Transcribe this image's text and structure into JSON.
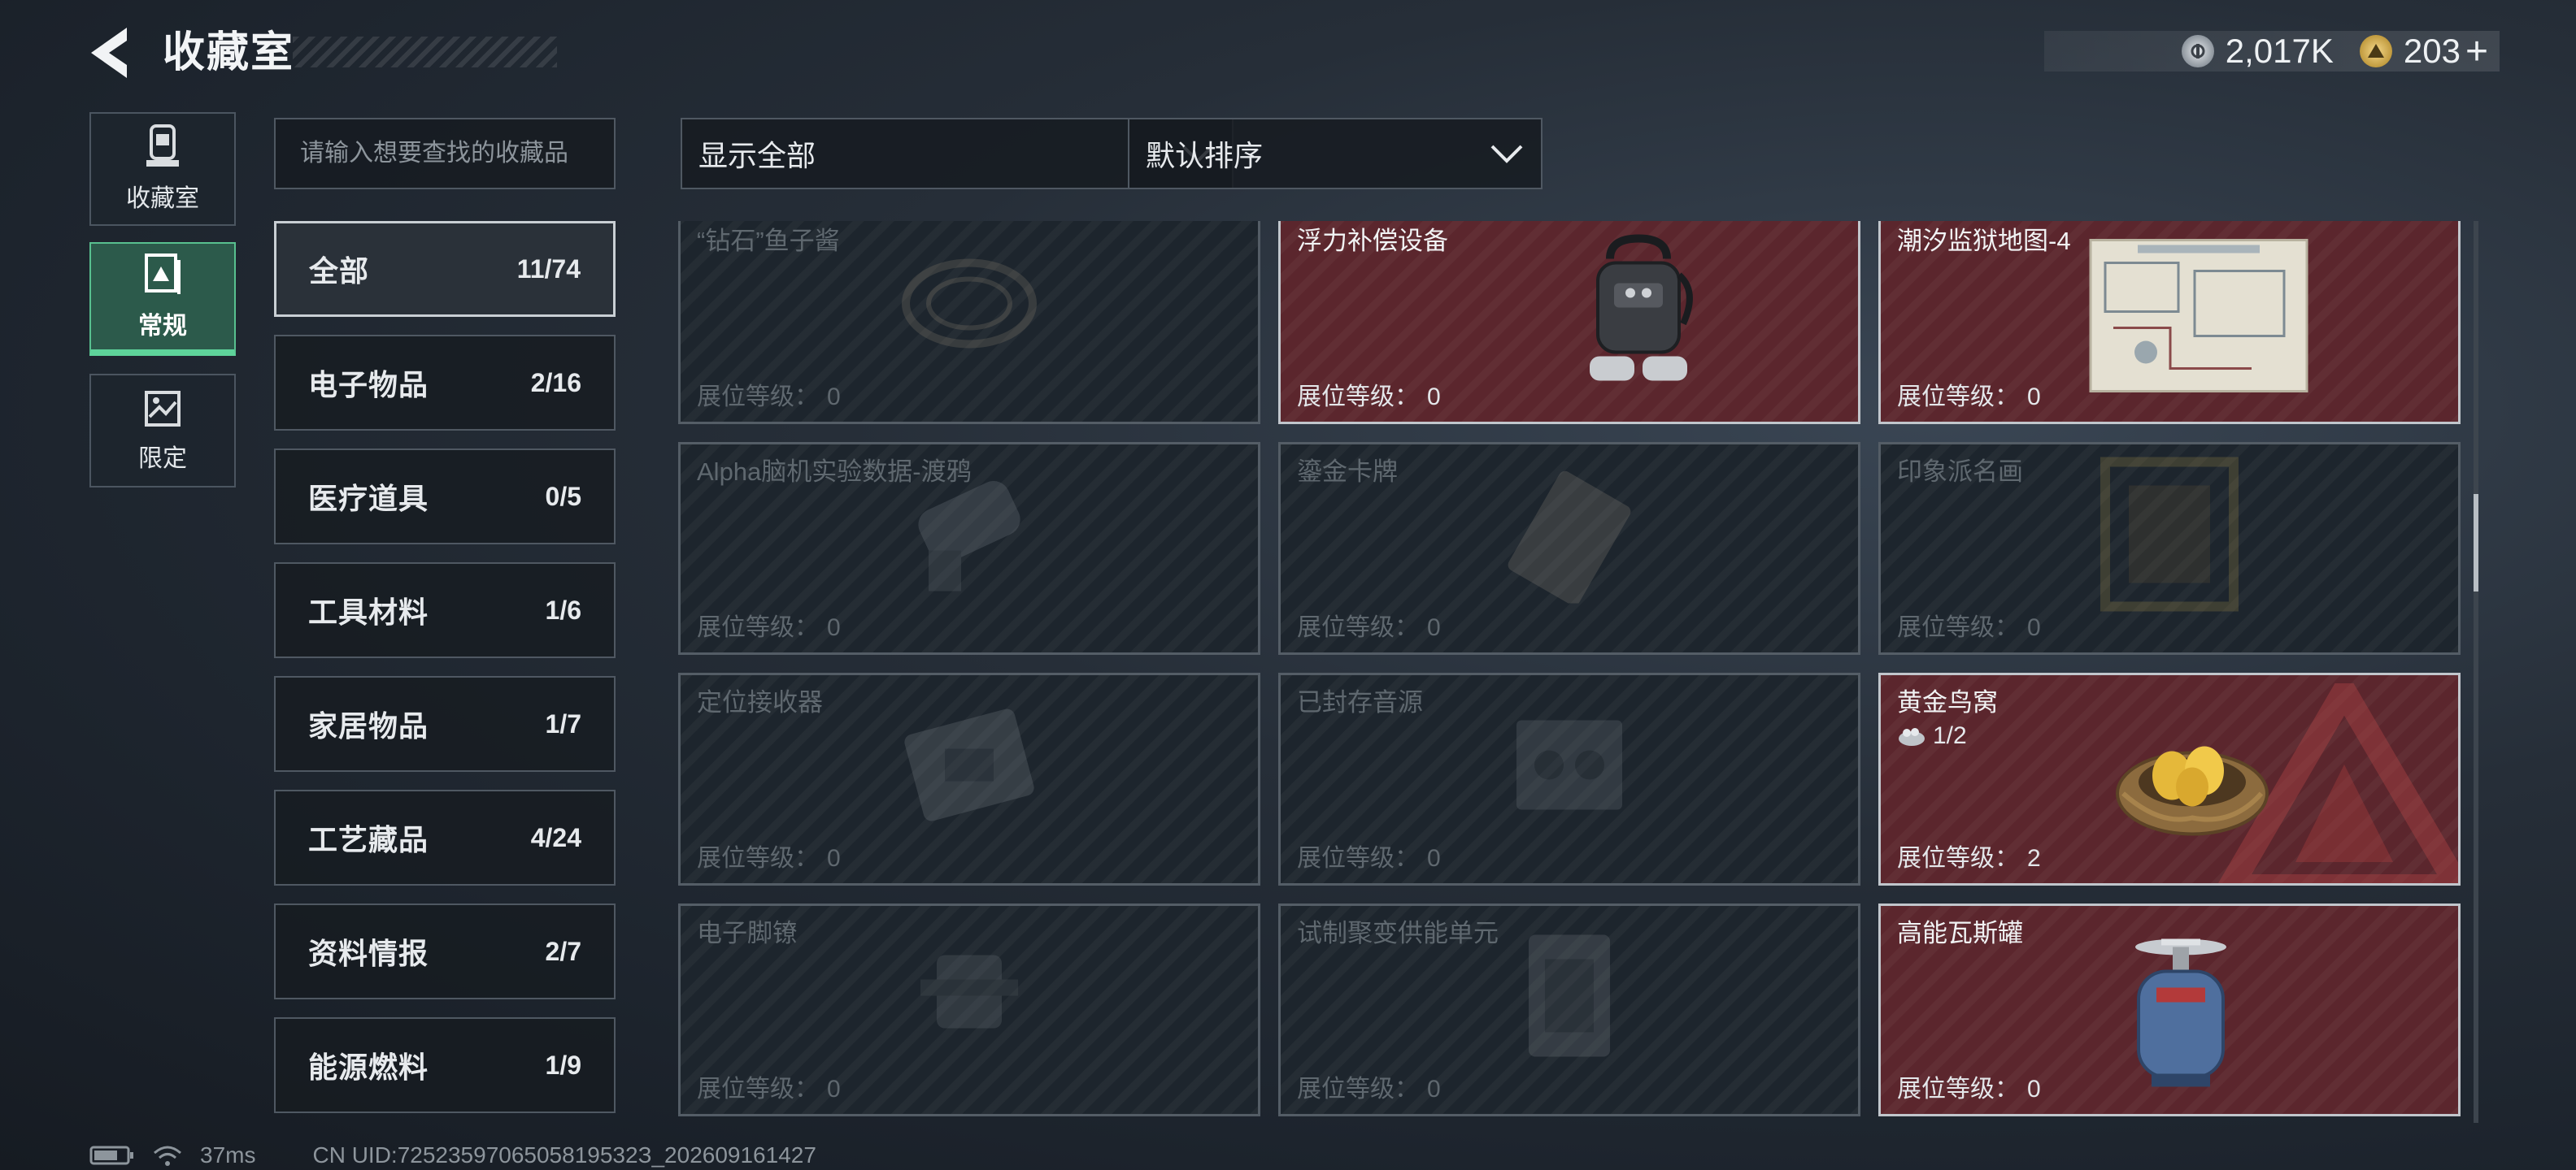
{
  "header": {
    "title": "收藏室"
  },
  "currency": {
    "silver_value": "2,017K",
    "gold_value": "203",
    "add_symbol": "+"
  },
  "rail": [
    {
      "label": "收藏室",
      "icon": "vault-icon",
      "active": false
    },
    {
      "label": "常规",
      "icon": "regular-collection-icon",
      "active": true
    },
    {
      "label": "限定",
      "icon": "limited-collection-icon",
      "active": false
    }
  ],
  "search": {
    "placeholder": "请输入想要查找的收藏品",
    "value": ""
  },
  "categories": [
    {
      "name": "全部",
      "count": "11/74",
      "active": true
    },
    {
      "name": "电子物品",
      "count": "2/16"
    },
    {
      "name": "医疗道具",
      "count": "0/5"
    },
    {
      "name": "工具材料",
      "count": "1/6"
    },
    {
      "name": "家居物品",
      "count": "1/7"
    },
    {
      "name": "工艺藏品",
      "count": "4/24"
    },
    {
      "name": "资料情报",
      "count": "2/7"
    },
    {
      "name": "能源燃料",
      "count": "1/9"
    }
  ],
  "filter": {
    "selected": "显示全部"
  },
  "sort": {
    "selected": "默认排序"
  },
  "level_label": "展位等级：",
  "items": [
    {
      "name": "“钻石”鱼子酱",
      "level": "0",
      "owned": false,
      "icon": "caviar-icon"
    },
    {
      "name": "浮力补偿设备",
      "level": "0",
      "owned": true,
      "icon": "buoyancy-device-icon"
    },
    {
      "name": "潮汐监狱地图-4",
      "level": "0",
      "owned": true,
      "icon": "prison-map-icon"
    },
    {
      "name": "Alpha脑机实验数据-渡鸦",
      "level": "0",
      "owned": false,
      "icon": "brain-data-icon"
    },
    {
      "name": "鎏金卡牌",
      "level": "0",
      "owned": false,
      "icon": "gold-card-icon"
    },
    {
      "name": "印象派名画",
      "level": "0",
      "owned": false,
      "icon": "painting-icon"
    },
    {
      "name": "定位接收器",
      "level": "0",
      "owned": false,
      "icon": "receiver-icon"
    },
    {
      "name": "已封存音源",
      "level": "0",
      "owned": false,
      "icon": "sealed-audio-icon"
    },
    {
      "name": "黄金鸟窝",
      "level": "2",
      "owned": true,
      "icon": "golden-nest-icon",
      "sub": "1/2"
    },
    {
      "name": "电子脚镣",
      "level": "0",
      "owned": false,
      "icon": "ankle-monitor-icon"
    },
    {
      "name": "试制聚变供能单元",
      "level": "0",
      "owned": false,
      "icon": "fusion-unit-icon"
    },
    {
      "name": "高能瓦斯罐",
      "level": "0",
      "owned": true,
      "icon": "gas-canister-icon"
    }
  ],
  "footer": {
    "ping": "37ms",
    "uid": "CN UID:7252359706505819532З_202609161427"
  }
}
